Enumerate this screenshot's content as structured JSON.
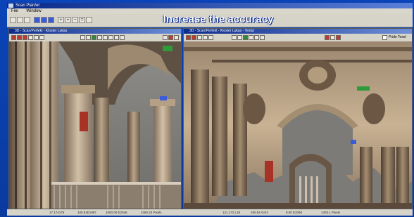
{
  "window": {
    "title": "Scan Plan/er"
  },
  "menu": {
    "items": [
      "File",
      "Window"
    ]
  },
  "headline": "Increase the accuracy",
  "left_viewer": {
    "title": "3D - Scan/Perfekt - Kloster Lukas"
  },
  "right_viewer": {
    "title": "3D - Scan/Perfekt - Kloster Lukas - Textur",
    "checkbox_label": "Pride Texel"
  },
  "status_left": [
    "17.174176",
    "100.81E1997",
    "1000.00 E2046",
    "2460.23 Pixels"
  ],
  "status_right": [
    "121.172 L19",
    "100.54 Gm3",
    "9.00 E2046",
    "1403.1 Pixels"
  ],
  "colors": {
    "frame": "#0b44b8",
    "headline": "#ffffff"
  }
}
